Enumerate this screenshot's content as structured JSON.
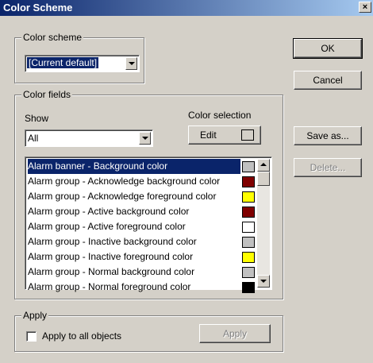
{
  "window": {
    "title": "Color Scheme",
    "close_glyph": "×"
  },
  "color_scheme": {
    "legend": "Color scheme",
    "selected": "[Current default]"
  },
  "color_fields": {
    "legend": "Color fields",
    "show_label": "Show",
    "show_selected": "All",
    "color_selection_label": "Color selection",
    "edit_label": "Edit",
    "items": [
      {
        "label": "Alarm banner - Background color",
        "color": "#c0c0c0",
        "selected": true
      },
      {
        "label": "Alarm group - Acknowledge background color",
        "color": "#800000",
        "selected": false
      },
      {
        "label": "Alarm group - Acknowledge foreground color",
        "color": "#ffff00",
        "selected": false
      },
      {
        "label": "Alarm group - Active background color",
        "color": "#800000",
        "selected": false
      },
      {
        "label": "Alarm group - Active foreground color",
        "color": "#ffffff",
        "selected": false
      },
      {
        "label": "Alarm group - Inactive background color",
        "color": "#c0c0c0",
        "selected": false
      },
      {
        "label": "Alarm group - Inactive foreground color",
        "color": "#ffff00",
        "selected": false
      },
      {
        "label": "Alarm group - Normal background color",
        "color": "#c0c0c0",
        "selected": false
      },
      {
        "label": "Alarm group - Normal foreground color",
        "color": "#000000",
        "selected": false
      }
    ]
  },
  "apply": {
    "legend": "Apply",
    "checkbox_label": "Apply to all objects",
    "checked": false,
    "button_label": "Apply"
  },
  "buttons": {
    "ok": "OK",
    "cancel": "Cancel",
    "save_as": "Save as...",
    "delete": "Delete..."
  }
}
